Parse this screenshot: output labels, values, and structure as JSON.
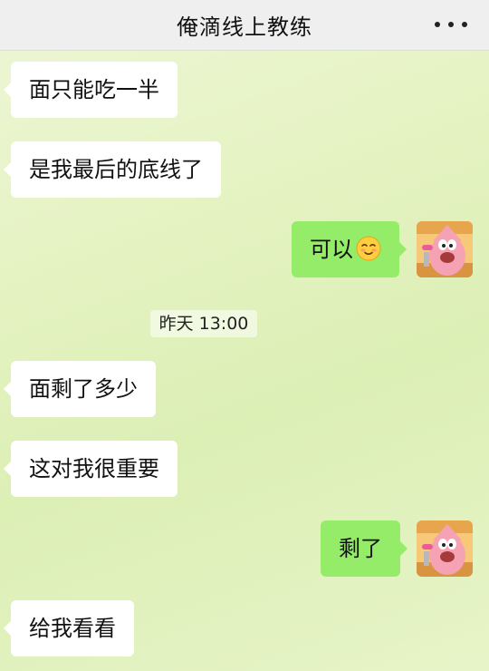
{
  "header": {
    "title": "俺滴线上教练",
    "more_icon": "more-icon"
  },
  "messages": [
    {
      "side": "left",
      "text": "面只能吃一半"
    },
    {
      "side": "left",
      "text": "是我最后的底线了"
    },
    {
      "side": "right",
      "text": "可以",
      "emoji": "smiling-face-emoji"
    },
    {
      "type": "timestamp",
      "text": "昨天 13:00"
    },
    {
      "side": "left",
      "text": "面剩了多少"
    },
    {
      "side": "left",
      "text": "这对我很重要"
    },
    {
      "side": "right",
      "text": "剩了"
    },
    {
      "side": "left",
      "text": "给我看看"
    }
  ],
  "colors": {
    "incoming_bubble": "#ffffff",
    "outgoing_bubble": "#95ec69",
    "header_bg": "#efefef"
  }
}
